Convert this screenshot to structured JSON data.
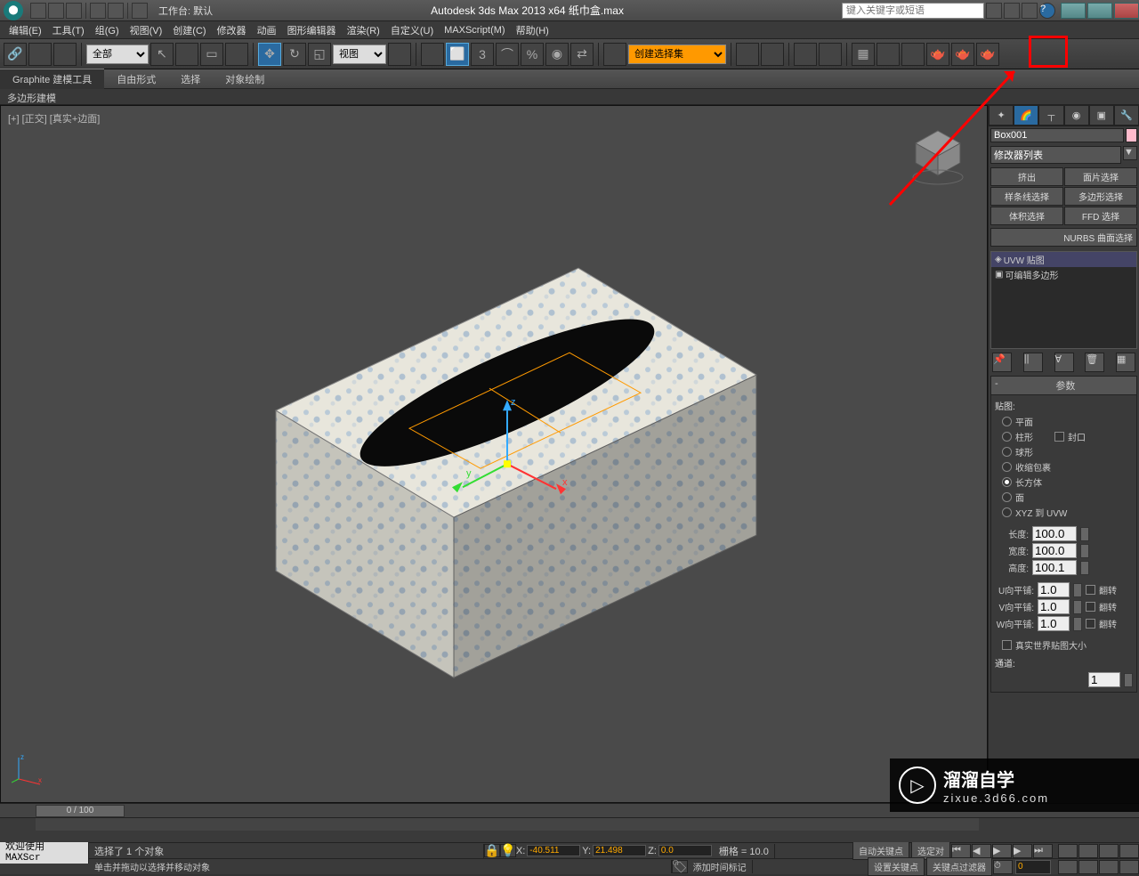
{
  "titlebar": {
    "workspace_label": "工作台: 默认",
    "title": "Autodesk 3ds Max  2013 x64   纸巾盒.max",
    "search_placeholder": "键入关键字或短语"
  },
  "menubar": {
    "items": [
      "编辑(E)",
      "工具(T)",
      "组(G)",
      "视图(V)",
      "创建(C)",
      "修改器",
      "动画",
      "图形编辑器",
      "渲染(R)",
      "自定义(U)",
      "MAXScript(M)",
      "帮助(H)"
    ]
  },
  "toolbar": {
    "filter_dd": "全部",
    "refcoord_dd": "视图",
    "named_sel_dd": "创建选择集"
  },
  "ribbon": {
    "tabs": [
      "Graphite 建模工具",
      "自由形式",
      "选择",
      "对象绘制"
    ],
    "sub": "多边形建模"
  },
  "viewport": {
    "label": "[+] [正交] [真实+边面]"
  },
  "cmdpanel": {
    "obj_name": "Box001",
    "modifier_list_label": "修改器列表",
    "mod_buttons": [
      "挤出",
      "面片选择",
      "样条线选择",
      "多边形选择",
      "体积选择",
      "FFD 选择"
    ],
    "nurbs_btn": "NURBS 曲面选择",
    "stack": [
      {
        "icon": "◈",
        "label": "UVW 贴图",
        "sel": true
      },
      {
        "icon": "▣",
        "label": "可编辑多边形",
        "sel": false
      }
    ],
    "params_header": "参数",
    "mapping_label": "贴图:",
    "mapping_options": [
      "平面",
      "柱形",
      "球形",
      "收缩包裹",
      "长方体",
      "面",
      "XYZ 到 UVW"
    ],
    "mapping_selected": 4,
    "cap_label": "封口",
    "dims": [
      {
        "label": "长度:",
        "val": "100.0"
      },
      {
        "label": "宽度:",
        "val": "100.0"
      },
      {
        "label": "高度:",
        "val": "100.1"
      }
    ],
    "tiles": [
      {
        "label": "U向平铺:",
        "val": "1.0",
        "flip": "翻转"
      },
      {
        "label": "V向平铺:",
        "val": "1.0",
        "flip": "翻转"
      },
      {
        "label": "W向平铺:",
        "val": "1.0",
        "flip": "翻转"
      }
    ],
    "realworld_label": "真实世界贴图大小",
    "channel_label": "通道:",
    "channel_val": "1"
  },
  "timeline": {
    "slider": "0 / 100"
  },
  "statusbar": {
    "welcome": "欢迎使用  MAXScr",
    "sel_msg": "选择了 1 个对象",
    "hint_msg": "单击并拖动以选择并移动对象",
    "x_label": "X:",
    "x_val": "-40.511",
    "y_label": "Y:",
    "y_val": "21.498",
    "z_label": "Z:",
    "z_val": "0.0",
    "grid": "栅格 = 10.0",
    "autokey": "自动关键点",
    "selkey": "选定对",
    "setkey": "设置关键点",
    "keyfilter": "关键点过滤器",
    "addtime": "添加时间标记"
  },
  "watermark": {
    "t1": "溜溜自学",
    "t2": "zixue.3d66.com"
  }
}
